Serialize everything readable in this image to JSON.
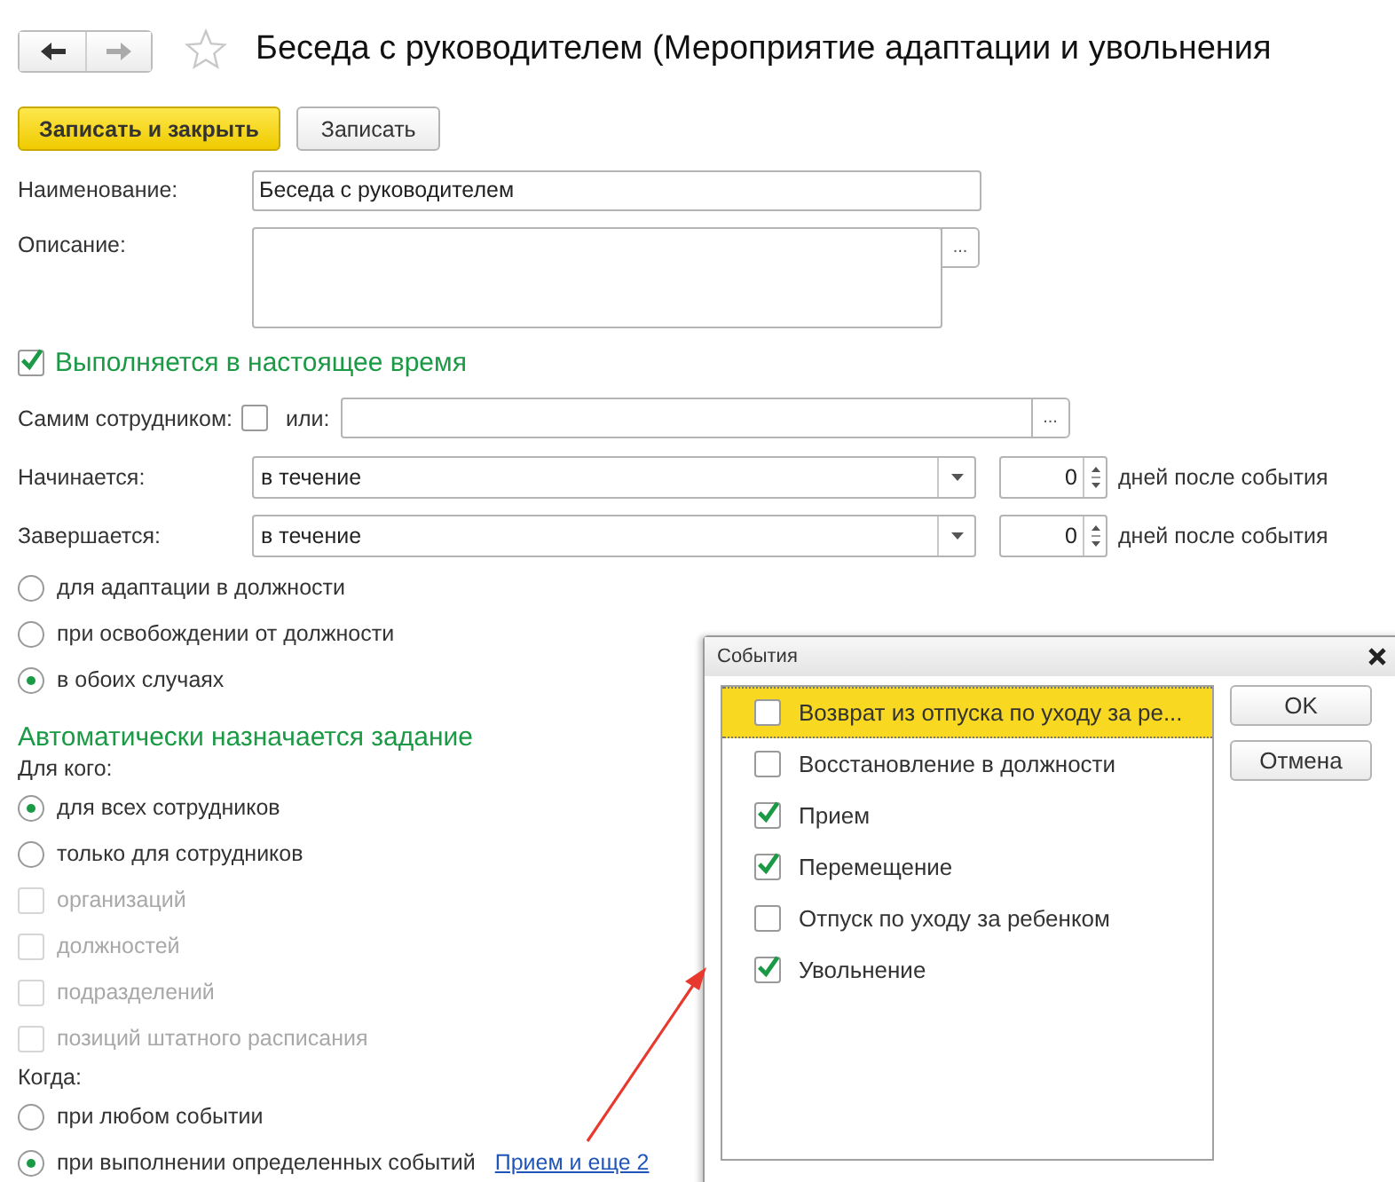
{
  "title": "Беседа с руководителем (Мероприятие адаптации и увольнения",
  "buttons": [
    {
      "label": "Записать и закрыть",
      "kind": "primary"
    },
    {
      "label": "Записать",
      "kind": "default"
    }
  ],
  "name_field": {
    "label": "Наименование:",
    "value": "Беседа с руководителем"
  },
  "description_field": {
    "label": "Описание:",
    "button": "..."
  },
  "current": {
    "label": "Выполняется в настоящее время",
    "checked": true
  },
  "self_row": {
    "label": "Самим сотрудником:",
    "checked": false,
    "or_label": "или:",
    "button": "..."
  },
  "periods": [
    {
      "label": "Начинается:",
      "value": "в течение",
      "count": "0",
      "suffix": "дней после события"
    },
    {
      "label": "Завершается:",
      "value": "в течение",
      "count": "0",
      "suffix": "дней после события"
    }
  ],
  "scope": [
    {
      "label": "для адаптации в должности",
      "selected": false
    },
    {
      "label": "при освобождении от должности",
      "selected": false
    },
    {
      "label": "в обоих случаях",
      "selected": true
    }
  ],
  "auto_heading": "Автоматически назначается задание",
  "for_whom": {
    "label": "Для кого:",
    "options": [
      {
        "label": "для всех сотрудников",
        "selected": true
      },
      {
        "label": "только для сотрудников",
        "selected": false
      }
    ]
  },
  "filters": [
    {
      "label": "организаций",
      "checked": false,
      "disabled": true
    },
    {
      "label": "должностей",
      "checked": false,
      "disabled": true
    },
    {
      "label": "подразделений",
      "checked": false,
      "disabled": true
    },
    {
      "label": "позиций штатного расписания",
      "checked": false,
      "disabled": true
    }
  ],
  "when": {
    "label": "Когда:",
    "options": [
      {
        "label": "при любом событии",
        "selected": false
      },
      {
        "label": "при выполнении определенных событий",
        "selected": true
      }
    ],
    "link": "Прием и еще 2"
  },
  "dialog": {
    "title": "События",
    "items": [
      {
        "label": "Возврат из отпуска по уходу за ре...",
        "checked": false,
        "selected": true
      },
      {
        "label": "Восстановление в должности",
        "checked": false,
        "selected": false
      },
      {
        "label": "Прием",
        "checked": true,
        "selected": false
      },
      {
        "label": "Перемещение",
        "checked": true,
        "selected": false
      },
      {
        "label": "Отпуск по уходу за ребенком",
        "checked": false,
        "selected": false
      },
      {
        "label": "Увольнение",
        "checked": true,
        "selected": false
      }
    ],
    "buttons": [
      "OK",
      "Отмена"
    ]
  }
}
